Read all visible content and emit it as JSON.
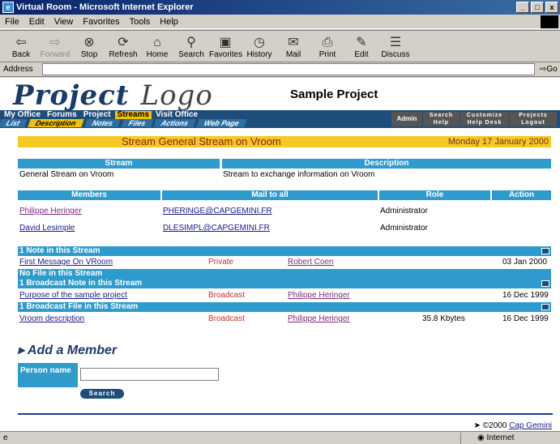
{
  "window": {
    "title": "Virtual Room - Microsoft Internet Explorer",
    "min_glyph": "_",
    "max_glyph": "□",
    "close_glyph": "x"
  },
  "menu": [
    "File",
    "Edit",
    "View",
    "Favorites",
    "Tools",
    "Help"
  ],
  "toolbar": {
    "back": "Back",
    "forward": "Forward",
    "stop": "Stop",
    "refresh": "Refresh",
    "home": "Home",
    "search": "Search",
    "favorites": "Favorites",
    "history": "History",
    "mail": "Mail",
    "print": "Print",
    "edit": "Edit",
    "discuss": "Discuss"
  },
  "address": {
    "label": "Address",
    "value": "",
    "go": "Go"
  },
  "page": {
    "logo_first": "Project",
    "logo_second": "Logo",
    "project_title": "Sample Project",
    "nav_top": [
      "My Office",
      "Forums",
      "Project",
      "Streams",
      "Visit Office"
    ],
    "nav_top_active": "Streams",
    "nav_sub": [
      "List",
      "Description",
      "Notes",
      "Files",
      "Actions",
      "Web Page"
    ],
    "nav_sub_active": "Description",
    "admin_label": "Admin",
    "right_nav": [
      "Search",
      "Customize",
      "Projects",
      "Help",
      "Help Desk",
      "Logout"
    ],
    "stream_title": "Stream General Stream on Vroom",
    "date": "Monday 17 January 2000",
    "stream_table": {
      "headers": [
        "Stream",
        "Description"
      ],
      "row": [
        "General Stream on Vroom",
        "Stream to exchange information on Vroom"
      ]
    },
    "members_table": {
      "headers": [
        "Members",
        "Mail to all",
        "Role",
        "Action"
      ],
      "rows": [
        {
          "name": "Philippe Heringer",
          "mail": "PHERINGE@CAPGEMINI.FR",
          "role": "Administrator"
        },
        {
          "name": "David Lesimple",
          "mail": "DLESIMPL@CAPGEMINI.FR",
          "role": "Administrator"
        }
      ]
    },
    "sections": {
      "notes_header": "1 Note in this Stream",
      "note": {
        "title": "First Message On VRoom",
        "type": "Private",
        "author": "Robert Coen",
        "date": "03 Jan 2000"
      },
      "files_header": "No File in this Stream",
      "bnotes_header": "1 Broadcast Note in this Stream",
      "bnote": {
        "title": "Purpose of the sample project",
        "type": "Broadcast",
        "author": "Philippe Heringer",
        "date": "16 Dec 1999"
      },
      "bfiles_header": "1 Broadcast File in this Stream",
      "bfile": {
        "title": "Vroom description",
        "type": "Broadcast",
        "author": "Philippe Heringer",
        "size": "35.8 Kbytes",
        "date": "16 Dec 1999"
      }
    },
    "add_member": {
      "heading": "Add a Member",
      "person_label": "Person name",
      "person_value": "",
      "search_button": "Search"
    },
    "copyright_prefix": "©2000",
    "copyright_link": "Cap Gemini"
  },
  "status": {
    "zone": "Internet"
  }
}
